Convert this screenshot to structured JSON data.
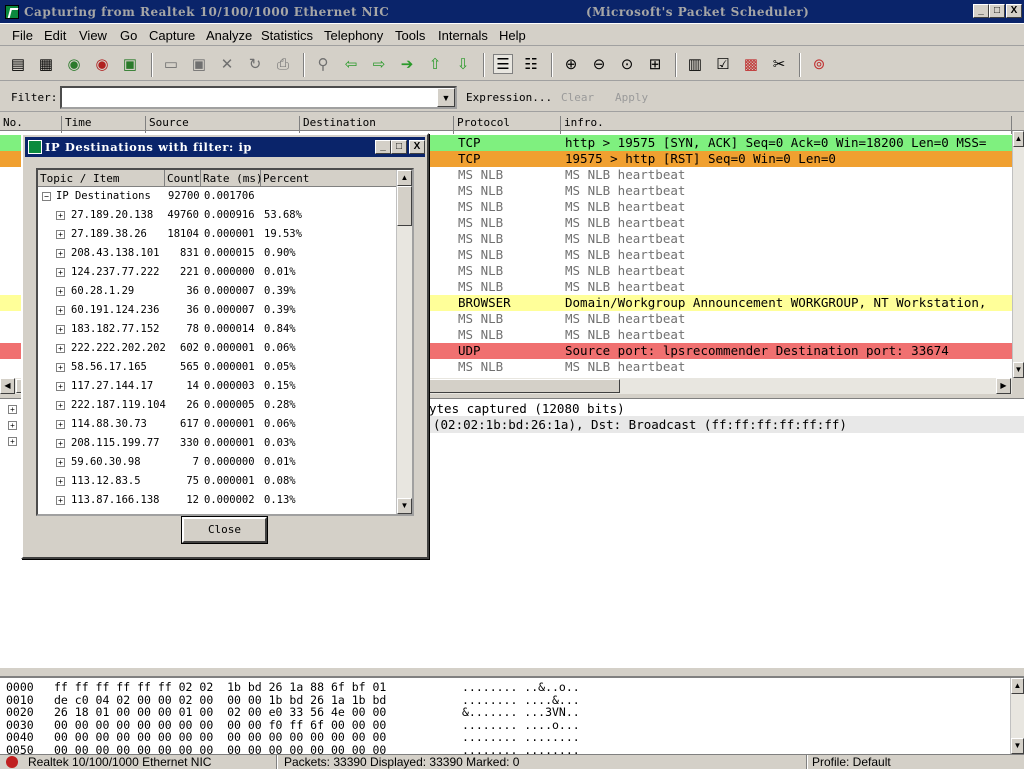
{
  "window": {
    "title": "Capturing from Realtek 10/100/1000 Ethernet NIC",
    "subtitle": "(Microsoft's Packet Scheduler)",
    "minimize": "_",
    "maximize": "□",
    "close": "X"
  },
  "menu": [
    "File",
    "Edit",
    "View",
    "Go",
    "Capture",
    "Analyze",
    "Statistics",
    "Telephony",
    "Tools",
    "Internals",
    "Help"
  ],
  "filter": {
    "label": "Filter:",
    "value": "",
    "expression": "Expression...",
    "clear": "Clear",
    "apply": "Apply"
  },
  "packet_list": {
    "columns": [
      "No.",
      "Time",
      "Source",
      "Destination",
      "Protocol",
      "infro."
    ],
    "rows": [
      {
        "protocol": "TCP",
        "info": "http > 19575 [SYN, ACK] Seq=0 Ack=0 Win=18200 Len=0 MSS=",
        "color": "#7ff07f"
      },
      {
        "protocol": "TCP",
        "info": "19575 > http [RST] Seq=0 Win=0 Len=0",
        "color": "#f0a030"
      },
      {
        "protocol": "MS NLB",
        "info": "MS NLB heartbeat",
        "color": "#ffffff"
      },
      {
        "protocol": "MS NLB",
        "info": "MS NLB heartbeat",
        "color": "#ffffff"
      },
      {
        "protocol": "MS NLB",
        "info": "MS NLB heartbeat",
        "color": "#ffffff"
      },
      {
        "protocol": "MS NLB",
        "info": "MS NLB heartbeat",
        "color": "#ffffff"
      },
      {
        "protocol": "MS NLB",
        "info": "MS NLB heartbeat",
        "color": "#ffffff"
      },
      {
        "protocol": "MS NLB",
        "info": "MS NLB heartbeat",
        "color": "#ffffff"
      },
      {
        "protocol": "MS NLB",
        "info": "MS NLB heartbeat",
        "color": "#ffffff"
      },
      {
        "protocol": "MS NLB",
        "info": "MS NLB heartbeat",
        "color": "#ffffff"
      },
      {
        "protocol": "BROWSER",
        "info": "Domain/Workgroup Announcement WORKGROUP, NT Workstation,",
        "color": "#ffff99"
      },
      {
        "protocol": "MS NLB",
        "info": "MS NLB heartbeat",
        "color": "#ffffff"
      },
      {
        "protocol": "MS NLB",
        "info": "MS NLB heartbeat",
        "color": "#ffffff"
      },
      {
        "protocol": "UDP",
        "info": "Source port: lpsrecommender  Destination port: 33674",
        "color": "#f07070"
      },
      {
        "protocol": "MS NLB",
        "info": "MS NLB heartbeat",
        "color": "#ffffff"
      }
    ]
  },
  "details": {
    "line1": "ytes captured (12080 bits)",
    "line2": "(02:02:1b:bd:26:1a), Dst: Broadcast (ff:ff:ff:ff:ff:ff)"
  },
  "hex": [
    {
      "offset": "0000",
      "bytes": "ff ff ff ff ff ff 02 02  1b bd 26 1a 88 6f bf 01",
      "ascii": "........ ..&..o.."
    },
    {
      "offset": "0010",
      "bytes": "de c0 04 02 00 00 02 00  00 00 1b bd 26 1a 1b bd",
      "ascii": "........ ....&..."
    },
    {
      "offset": "0020",
      "bytes": "26 18 01 00 00 00 01 00  02 00 e0 33 56 4e 00 00",
      "ascii": "&....... ...3VN.."
    },
    {
      "offset": "0030",
      "bytes": "00 00 00 00 00 00 00 00  00 00 f0 ff 6f 00 00 00",
      "ascii": "........ ....o..."
    },
    {
      "offset": "0040",
      "bytes": "00 00 00 00 00 00 00 00  00 00 00 00 00 00 00 00",
      "ascii": "........ ........"
    },
    {
      "offset": "0050",
      "bytes": "00 00 00 00 00 00 00 00  00 00 00 00 00 00 00 00",
      "ascii": "........ ........"
    }
  ],
  "status": {
    "interface": "Realtek 10/100/1000 Ethernet NIC",
    "packets": "Packets: 33390 Displayed: 33390 Marked: 0",
    "profile": "Profile: Default"
  },
  "dialog": {
    "title": "IP Destinations with filter: ip",
    "columns": [
      "Topic / Item",
      "Count",
      "Rate (ms)",
      "Percent"
    ],
    "root": {
      "item": "IP Destinations",
      "count": "92700",
      "rate": "0.001706",
      "percent": ""
    },
    "items": [
      {
        "item": "27.189.20.138",
        "count": "49760",
        "rate": "0.000916",
        "percent": "53.68%"
      },
      {
        "item": "27.189.38.26",
        "count": "18104",
        "rate": "0.000001",
        "percent": "19.53%"
      },
      {
        "item": "208.43.138.101",
        "count": "831",
        "rate": "0.000015",
        "percent": "0.90%"
      },
      {
        "item": "124.237.77.222",
        "count": "221",
        "rate": "0.000000",
        "percent": "0.01%"
      },
      {
        "item": "60.28.1.29",
        "count": "36",
        "rate": "0.000007",
        "percent": "0.39%"
      },
      {
        "item": "60.191.124.236",
        "count": "36",
        "rate": "0.000007",
        "percent": "0.39%"
      },
      {
        "item": "183.182.77.152",
        "count": "78",
        "rate": "0.000014",
        "percent": "0.84%"
      },
      {
        "item": "222.222.202.202",
        "count": "602",
        "rate": "0.000001",
        "percent": "0.06%"
      },
      {
        "item": "58.56.17.165",
        "count": "565",
        "rate": "0.000001",
        "percent": "0.05%"
      },
      {
        "item": "117.27.144.17",
        "count": "14",
        "rate": "0.000003",
        "percent": "0.15%"
      },
      {
        "item": "222.187.119.104",
        "count": "26",
        "rate": "0.000005",
        "percent": "0.28%"
      },
      {
        "item": "114.88.30.73",
        "count": "617",
        "rate": "0.000001",
        "percent": "0.06%"
      },
      {
        "item": "208.115.199.77",
        "count": "330",
        "rate": "0.000001",
        "percent": "0.03%"
      },
      {
        "item": "59.60.30.98",
        "count": "7",
        "rate": "0.000000",
        "percent": "0.01%"
      },
      {
        "item": "113.12.83.5",
        "count": "75",
        "rate": "0.000001",
        "percent": "0.08%"
      },
      {
        "item": "113.87.166.138",
        "count": "12",
        "rate": "0.000002",
        "percent": "0.13%"
      }
    ],
    "close_label": "Close"
  },
  "toolbar_icons": [
    "interfaces-icon",
    "options-icon",
    "start-icon",
    "stop-icon",
    "restart-icon",
    "open-icon",
    "save-icon",
    "close-file-icon",
    "reload-icon",
    "print-icon",
    "find-icon",
    "back-icon",
    "forward-icon",
    "goto-icon",
    "first-icon",
    "last-icon",
    "colorize-icon",
    "autoscroll-icon",
    "zoom-in-icon",
    "zoom-out-icon",
    "zoom-normal-icon",
    "resize-columns-icon",
    "capture-filters-icon",
    "display-filters-icon",
    "coloring-rules-icon",
    "preferences-icon",
    "help-icon"
  ]
}
